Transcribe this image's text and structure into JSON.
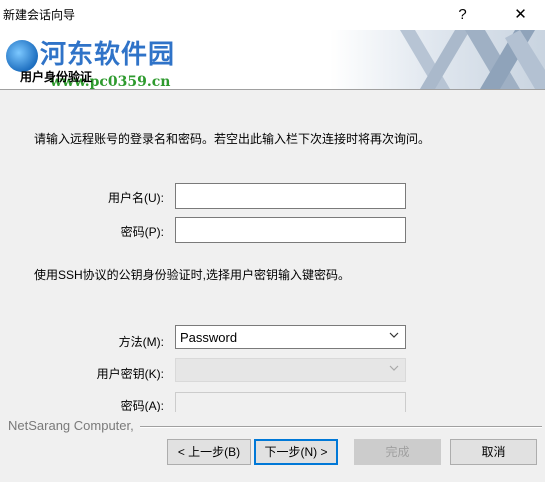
{
  "window": {
    "title": "新建会话向导",
    "help": "?",
    "close": "✕"
  },
  "watermark": {
    "site": "河东软件园",
    "url": "www.pc0359.cn"
  },
  "header": {
    "subtitle": "用户身份验证"
  },
  "main": {
    "intro": "请输入远程账号的登录名和密码。若空出此输入栏下次连接时将再次询问。",
    "username_label": "用户名(U):",
    "username_value": "",
    "password_label": "密码(P):",
    "password_value": "",
    "pubkey_note": "使用SSH协议的公钥身份验证时,选择用户密钥输入键密码。",
    "method_label": "方法(M):",
    "method_value": "Password",
    "userkey_label": "用户密钥(K):",
    "userkey_value": "",
    "passphrase_label": "密码(A):"
  },
  "footer": {
    "company": "NetSarang Computer,",
    "back": "< 上一步(B)",
    "next": "下一步(N) >",
    "finish": "完成",
    "cancel": "取消"
  }
}
